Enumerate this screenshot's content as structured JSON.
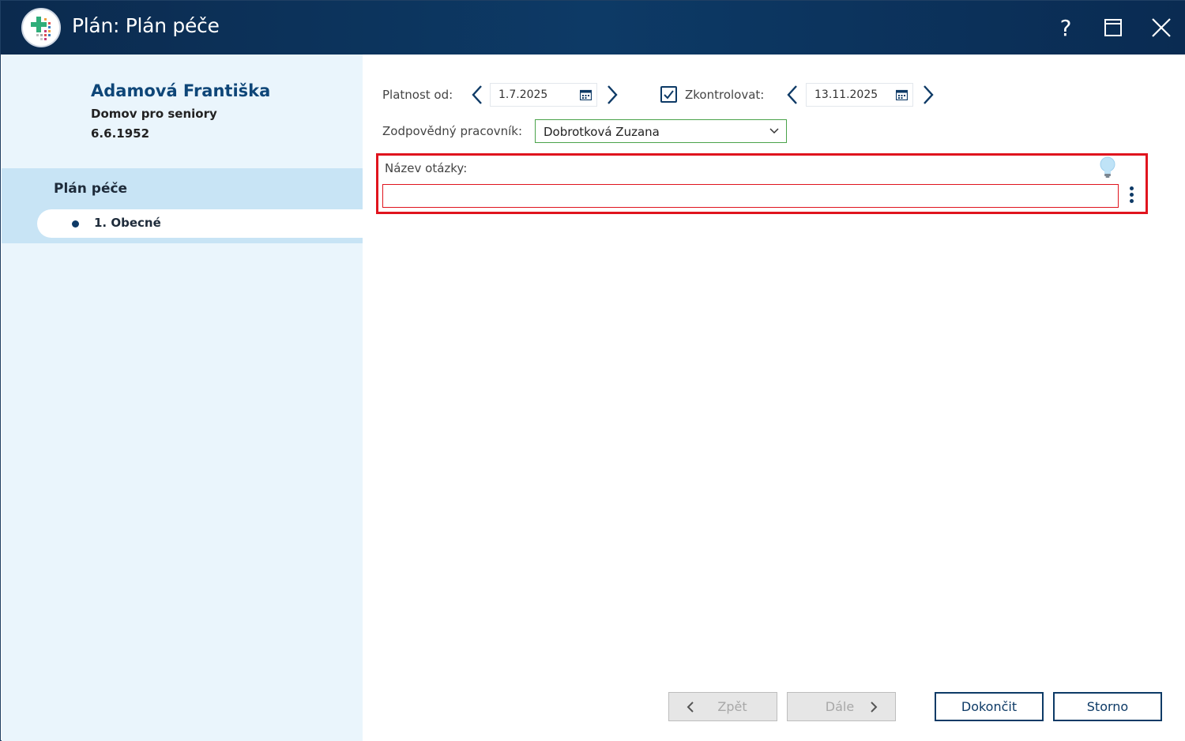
{
  "window": {
    "title": "Plán: Plán péče",
    "controls": {
      "help": "?"
    }
  },
  "patient": {
    "name": "Adamová Františka",
    "facility": "Domov pro seniory",
    "birth_date": "6.6.1952"
  },
  "sidebar": {
    "group_label": "Plán péče",
    "items": [
      {
        "label": "1. Obecné",
        "selected": true
      }
    ]
  },
  "form": {
    "valid_from_label": "Platnost od:",
    "valid_from_value": "1.7.2025",
    "check_label": "Zkontrolovat:",
    "check_checked": true,
    "check_value": "13.11.2025",
    "responsible_label": "Zodpovědný pracovník:",
    "responsible_value": "Dobrotková Zuzana",
    "question_label": "Název otázky:",
    "question_value": ""
  },
  "buttons": {
    "back": "Zpět",
    "next": "Dále",
    "finish": "Dokončit",
    "cancel": "Storno"
  },
  "icons": [
    "app-logo",
    "help-icon",
    "maximize-icon",
    "close-icon",
    "chevron-left-icon",
    "chevron-right-icon",
    "calendar-icon",
    "checkbox-checked-icon",
    "chevron-down-icon",
    "lightbulb-icon",
    "more-vertical-icon"
  ],
  "colors": {
    "titlebar": "#0d3a66",
    "sidebar_bg": "#eaf5fc",
    "sidebar_selected_group": "#c8e4f5",
    "accent": "#0d3a66",
    "error_red": "#e0141e",
    "valid_green": "#4aa34a"
  }
}
